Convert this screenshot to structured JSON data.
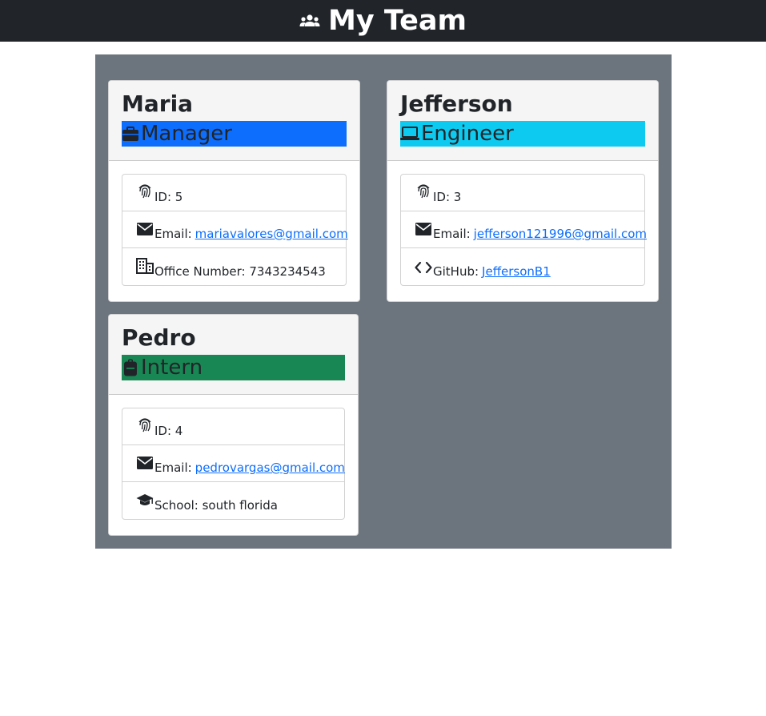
{
  "header": {
    "title": "My Team",
    "icon": "people-icon"
  },
  "colors": {
    "manager": "#0d6efd",
    "engineer": "#0dcaf0",
    "intern": "#198754",
    "panel": "#6c757d",
    "navbar": "#212529"
  },
  "employees": [
    {
      "name": "Maria",
      "role": "Manager",
      "role_icon": "briefcase-icon",
      "id_label": "ID: 5",
      "email_label": "Email:",
      "email": "mariavalores@gmail.com",
      "extra_label": "Office Number: 7343234543",
      "extra_icon": "building-icon"
    },
    {
      "name": "Jefferson",
      "role": "Engineer",
      "role_icon": "laptop-icon",
      "id_label": "ID: 3",
      "email_label": "Email:",
      "email": "jefferson121996@gmail.com",
      "extra_label": "GitHub:",
      "extra_link": "JeffersonB1",
      "extra_icon": "code-icon"
    },
    {
      "name": "Pedro",
      "role": "Intern",
      "role_icon": "backpack-icon",
      "id_label": "ID: 4",
      "email_label": "Email:",
      "email": "pedrovargas@gmail.com",
      "extra_label": "School: south florida",
      "extra_icon": "graduation-cap-icon"
    }
  ]
}
